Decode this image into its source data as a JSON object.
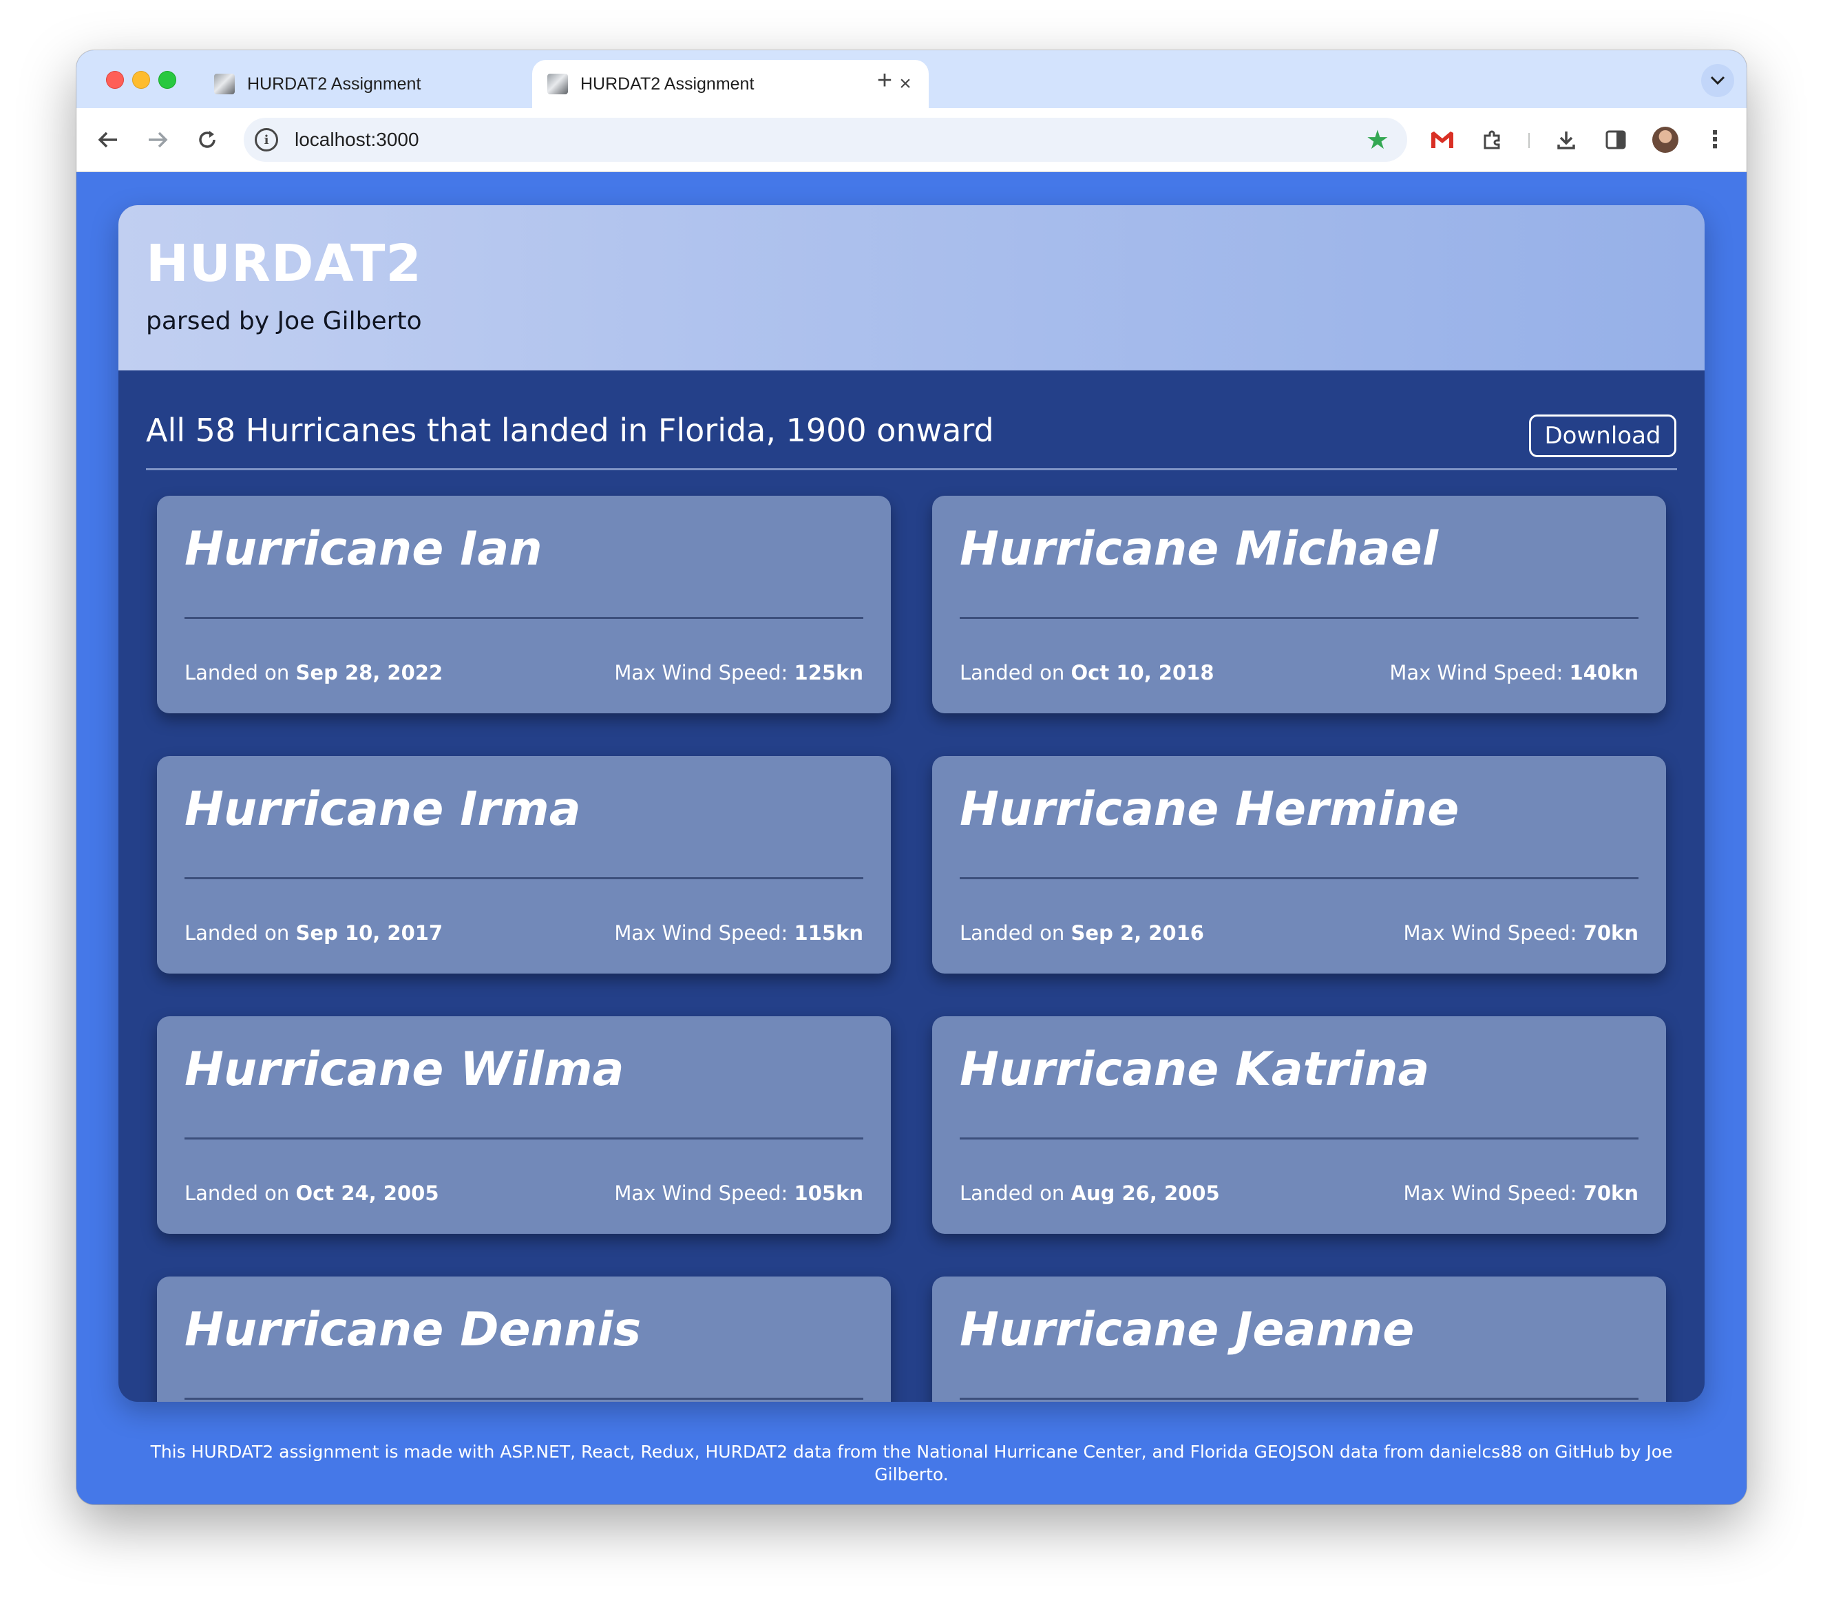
{
  "browser": {
    "tabs": [
      {
        "title": "HURDAT2 Assignment",
        "active": false
      },
      {
        "title": "HURDAT2 Assignment",
        "active": true
      }
    ],
    "new_tab_label": "+",
    "url": "localhost:3000"
  },
  "header": {
    "title": "HURDAT2",
    "subtitle": "parsed by Joe Gilberto"
  },
  "section": {
    "title": "All 58 Hurricanes that landed in Florida, 1900 onward",
    "download_label": "Download"
  },
  "card_labels": {
    "landed_prefix": "Landed on",
    "wind_prefix": "Max Wind Speed:"
  },
  "hurricanes": [
    {
      "name": "Hurricane Ian",
      "landed": "Sep 28, 2022",
      "wind": "125kn"
    },
    {
      "name": "Hurricane Michael",
      "landed": "Oct 10, 2018",
      "wind": "140kn"
    },
    {
      "name": "Hurricane Irma",
      "landed": "Sep 10, 2017",
      "wind": "115kn"
    },
    {
      "name": "Hurricane Hermine",
      "landed": "Sep 2, 2016",
      "wind": "70kn"
    },
    {
      "name": "Hurricane Wilma",
      "landed": "Oct 24, 2005",
      "wind": "105kn"
    },
    {
      "name": "Hurricane Katrina",
      "landed": "Aug 26, 2005",
      "wind": "70kn"
    },
    {
      "name": "Hurricane Dennis",
      "landed": "",
      "wind": ""
    },
    {
      "name": "Hurricane Jeanne",
      "landed": "",
      "wind": ""
    }
  ],
  "footer": {
    "text": "This HURDAT2 assignment is made with ASP.NET, React, Redux, HURDAT2 data from the National Hurricane Center, and Florida GEOJSON data from danielcs88 on GitHub by Joe Gilberto."
  },
  "icons": {
    "back": "arrow-left-icon",
    "forward": "arrow-right-icon",
    "reload": "reload-icon",
    "site_info": "info-icon",
    "bookmark": "star-icon",
    "gmail": "gmail-icon",
    "extensions": "puzzle-icon",
    "downloads": "download-icon",
    "side_panel": "side-panel-icon",
    "profile": "avatar-icon",
    "menu": "kebab-menu-icon"
  },
  "colors": {
    "page_background": "#4578e8",
    "app_panel": "#244089",
    "card": "#7289b9",
    "bookmark_star": "#34a853"
  }
}
